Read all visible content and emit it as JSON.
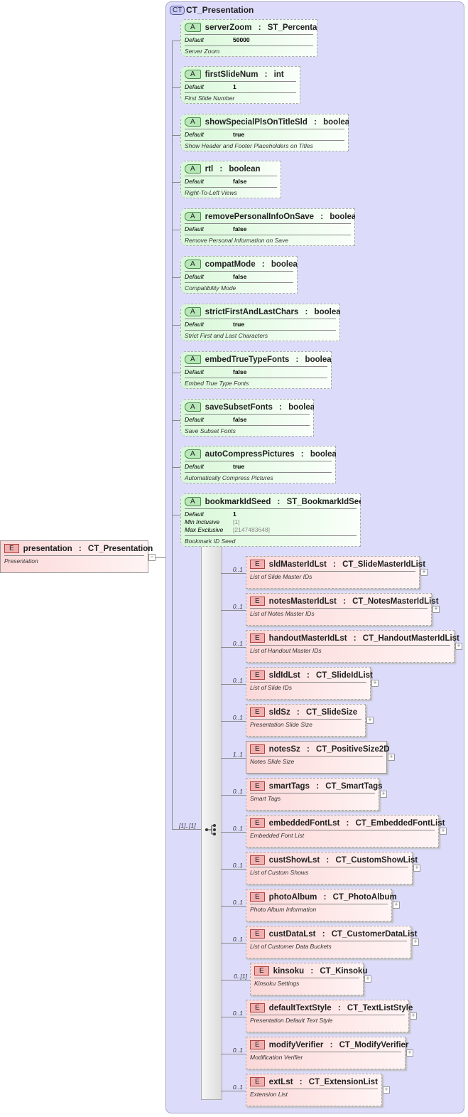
{
  "root": {
    "tag": "E",
    "name": "presentation",
    "type": "CT_Presentation",
    "desc": "Presentation"
  },
  "complex_type": {
    "tag": "CT",
    "name": "CT_Presentation"
  },
  "sequence_cardinality": "[1]..[1]",
  "attributes": [
    {
      "name": "serverZoom",
      "type": "ST_Percentage",
      "props": [
        [
          "Default",
          "50000"
        ]
      ],
      "desc": "Server Zoom"
    },
    {
      "name": "firstSlideNum",
      "type": "int",
      "props": [
        [
          "Default",
          "1"
        ]
      ],
      "desc": "First Slide Number"
    },
    {
      "name": "showSpecialPlsOnTitleSld",
      "type": "boolean",
      "props": [
        [
          "Default",
          "true"
        ]
      ],
      "desc": "Show Header and Footer Placeholders on Titles"
    },
    {
      "name": "rtl",
      "type": "boolean",
      "props": [
        [
          "Default",
          "false"
        ]
      ],
      "desc": "Right-To-Left Views"
    },
    {
      "name": "removePersonalInfoOnSave",
      "type": "boolean",
      "props": [
        [
          "Default",
          "false"
        ]
      ],
      "desc": "Remove Personal Information on Save"
    },
    {
      "name": "compatMode",
      "type": "boolean",
      "props": [
        [
          "Default",
          "false"
        ]
      ],
      "desc": "Compatibility Mode"
    },
    {
      "name": "strictFirstAndLastChars",
      "type": "boolean",
      "props": [
        [
          "Default",
          "true"
        ]
      ],
      "desc": "Strict First and Last Characters"
    },
    {
      "name": "embedTrueTypeFonts",
      "type": "boolean",
      "props": [
        [
          "Default",
          "false"
        ]
      ],
      "desc": "Embed True Type Fonts"
    },
    {
      "name": "saveSubsetFonts",
      "type": "boolean",
      "props": [
        [
          "Default",
          "false"
        ]
      ],
      "desc": "Save Subset Fonts"
    },
    {
      "name": "autoCompressPictures",
      "type": "boolean",
      "props": [
        [
          "Default",
          "true"
        ]
      ],
      "desc": "Automatically Compress Pictures"
    },
    {
      "name": "bookmarkIdSeed",
      "type": "ST_BookmarkIdSeed",
      "props": [
        [
          "Default",
          "1"
        ],
        [
          "Min Inclusive",
          "[1]"
        ],
        [
          "Max Exclusive",
          "[2147483648]"
        ]
      ],
      "desc": "Bookmark ID Seed"
    }
  ],
  "elements": [
    {
      "card": "0..1",
      "name": "sldMasterIdLst",
      "type": "CT_SlideMasterIdList",
      "desc": "List of Slide Master IDs"
    },
    {
      "card": "0..1",
      "name": "notesMasterIdLst",
      "type": "CT_NotesMasterIdList",
      "desc": "List of Notes Master IDs"
    },
    {
      "card": "0..1",
      "name": "handoutMasterIdLst",
      "type": "CT_HandoutMasterIdList",
      "desc": "List of Handout Master IDs"
    },
    {
      "card": "0..1",
      "name": "sldIdLst",
      "type": "CT_SlideIdList",
      "desc": "List of Slide IDs"
    },
    {
      "card": "0..1",
      "name": "sldSz",
      "type": "CT_SlideSize",
      "desc": "Presentation Slide Size"
    },
    {
      "card": "1..1",
      "name": "notesSz",
      "type": "CT_PositiveSize2D",
      "desc": "Notes Slide Size"
    },
    {
      "card": "0..1",
      "name": "smartTags",
      "type": "CT_SmartTags",
      "desc": "Smart Tags"
    },
    {
      "card": "0..1",
      "name": "embeddedFontLst",
      "type": "CT_EmbeddedFontList",
      "desc": "Embedded Font List"
    },
    {
      "card": "0..1",
      "name": "custShowLst",
      "type": "CT_CustomShowList",
      "desc": "List of Custom Shows"
    },
    {
      "card": "0..1",
      "name": "photoAlbum",
      "type": "CT_PhotoAlbum",
      "desc": "Photo Album Information"
    },
    {
      "card": "0..1",
      "name": "custDataLst",
      "type": "CT_CustomerDataList",
      "desc": "List of Customer Data Buckets"
    },
    {
      "card": "0..[1]",
      "name": "kinsoku",
      "type": "CT_Kinsoku",
      "desc": "Kinsoku Settings"
    },
    {
      "card": "0..1",
      "name": "defaultTextStyle",
      "type": "CT_TextListStyle",
      "desc": "Presentation Default Text Style"
    },
    {
      "card": "0..1",
      "name": "modifyVerifier",
      "type": "CT_ModifyVerifier",
      "desc": "Modification Verifier"
    },
    {
      "card": "0..1",
      "name": "extLst",
      "type": "CT_ExtensionList",
      "desc": "Extension List"
    }
  ]
}
